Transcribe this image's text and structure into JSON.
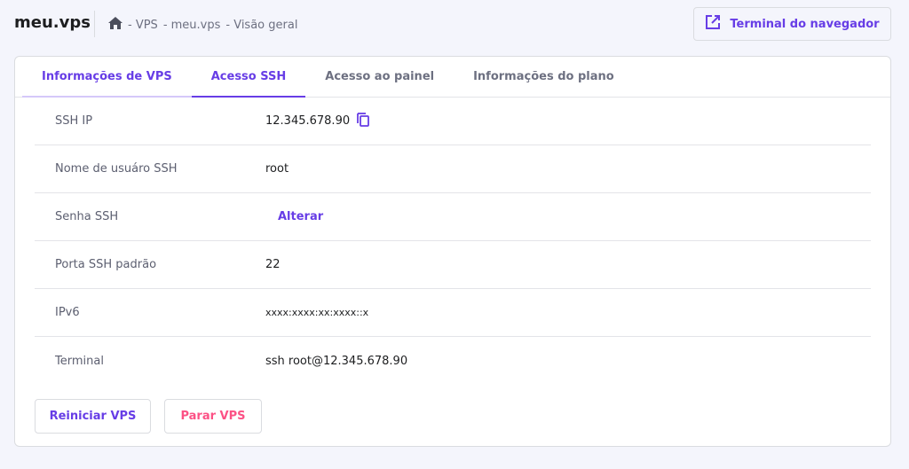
{
  "header": {
    "title": "meu.vps",
    "breadcrumb": [
      "- VPS",
      "- meu.vps",
      "- Visão geral"
    ],
    "terminal_button": "Terminal do navegador"
  },
  "tabs": [
    {
      "label": "Informações de VPS"
    },
    {
      "label": "Acesso SSH"
    },
    {
      "label": "Acesso ao painel"
    },
    {
      "label": "Informações do plano"
    }
  ],
  "rows": [
    {
      "label": "SSH IP",
      "value": "12.345.678.90"
    },
    {
      "label": "Nome de usuáro SSH",
      "value": "root"
    },
    {
      "label": "Senha SSH",
      "value": "Alterar"
    },
    {
      "label": "Porta SSH padrão",
      "value": "22"
    },
    {
      "label": "IPv6",
      "value": "xxxx:xxxx:xx:xxxx::x"
    },
    {
      "label": "Terminal",
      "value": "ssh root@12.345.678.90"
    }
  ],
  "actions": {
    "restart": "Reiniciar VPS",
    "stop": "Parar VPS"
  },
  "colors": {
    "accent": "#673de6",
    "danger": "#fc5185"
  }
}
